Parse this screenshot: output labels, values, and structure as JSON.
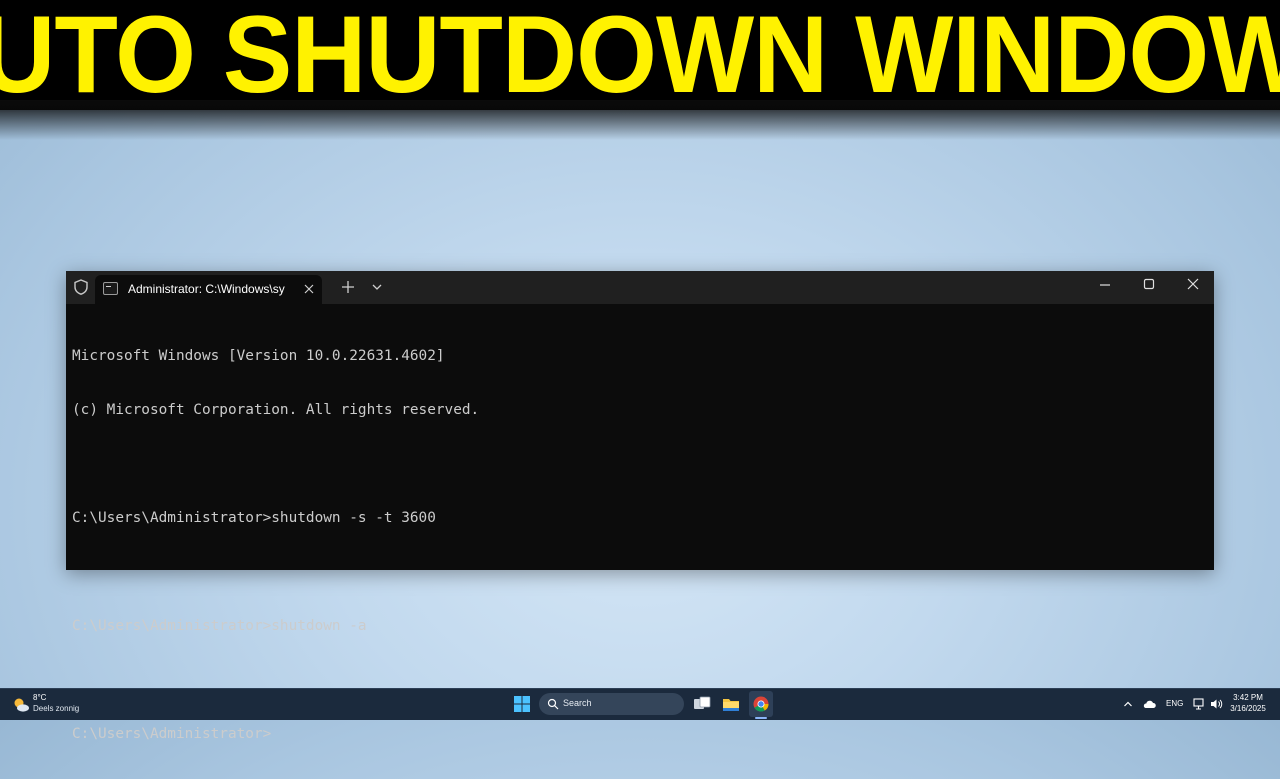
{
  "banner": {
    "headline": "AUTO SHUTDOWN WINDOWS"
  },
  "terminal": {
    "tab_title": "Administrator: C:\\Windows\\sy",
    "icons": [
      "shield-icon",
      "terminal-icon",
      "close-icon",
      "plus-icon",
      "chevron-down-icon",
      "minimize-icon",
      "maximize-icon"
    ],
    "lines": [
      "Microsoft Windows [Version 10.0.22631.4602]",
      "(c) Microsoft Corporation. All rights reserved.",
      "",
      "C:\\Users\\Administrator>shutdown -s -t 3600",
      "",
      "C:\\Users\\Administrator>shutdown -a",
      "",
      "C:\\Users\\Administrator>"
    ]
  },
  "taskbar": {
    "weather": {
      "temp": "8°C",
      "desc": "Deels zonnig"
    },
    "search_placeholder": "Search",
    "language": "ENG",
    "time": "3:42 PM",
    "date": "3/16/2025",
    "icons": [
      "weather-icon",
      "windows-start-icon",
      "search-icon",
      "task-view-icon",
      "file-explorer-icon",
      "chrome-icon",
      "chevron-up-icon",
      "onedrive-icon",
      "network-icon",
      "volume-icon"
    ]
  },
  "colors": {
    "headline": "#fff200",
    "banner_bg": "#000000",
    "console_bg": "#0c0c0c",
    "console_text": "#cccccc",
    "titlebar": "#202020",
    "taskbar": "#1b2a3d"
  }
}
